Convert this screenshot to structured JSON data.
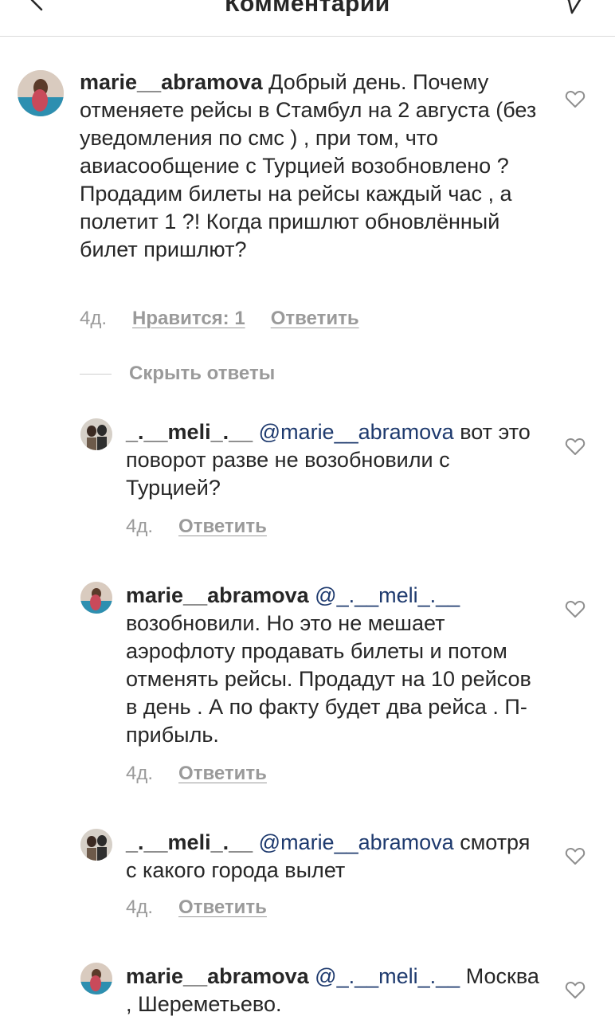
{
  "header": {
    "title": "Комментарии",
    "back_icon": "back-chevron-icon",
    "send_icon": "direct-send-icon"
  },
  "comments": [
    {
      "username": "marie__abramova",
      "text": "Добрый день. Почему отменяете рейсы в Стамбул на 2 августа (без уведомления по смс ) , при том, что авиасообщение с Турцией возобновлено ?  Продадим билеты на рейсы каждый час , а полетит 1 ?! Когда пришлют обновлённый билет пришлют?",
      "time": "4д.",
      "likes": "Нравится: 1",
      "reply": "Ответить"
    }
  ],
  "hide_replies": "Скрыть ответы",
  "replies": [
    {
      "username": "_.__meli_.__",
      "mention": "@marie__abramova",
      "text": "вот это поворот разве не возобновили с Турцией?",
      "time": "4д.",
      "reply": "Ответить"
    },
    {
      "username": "marie__abramova",
      "mention": "@_.__meli_.__",
      "text": "возобновили. Но это не мешает аэрофлоту продавать билеты и потом отменять рейсы. Продадут на 10 рейсов в день . А по факту будет два рейса . П-прибыль.",
      "time": "4д.",
      "reply": "Ответить"
    },
    {
      "username": "_.__meli_.__",
      "mention": "@marie__abramova",
      "text": "смотря с какого города вылет",
      "time": "4д.",
      "reply": "Ответить"
    },
    {
      "username": "marie__abramova",
      "mention": "@_.__meli_.__",
      "text": "Москва , Шереметьево.",
      "time": "",
      "reply": ""
    }
  ],
  "colors": {
    "text": "#262626",
    "meta": "#9a9a9a",
    "mention": "#1e3a6e",
    "divider": "#dbdbdb"
  }
}
